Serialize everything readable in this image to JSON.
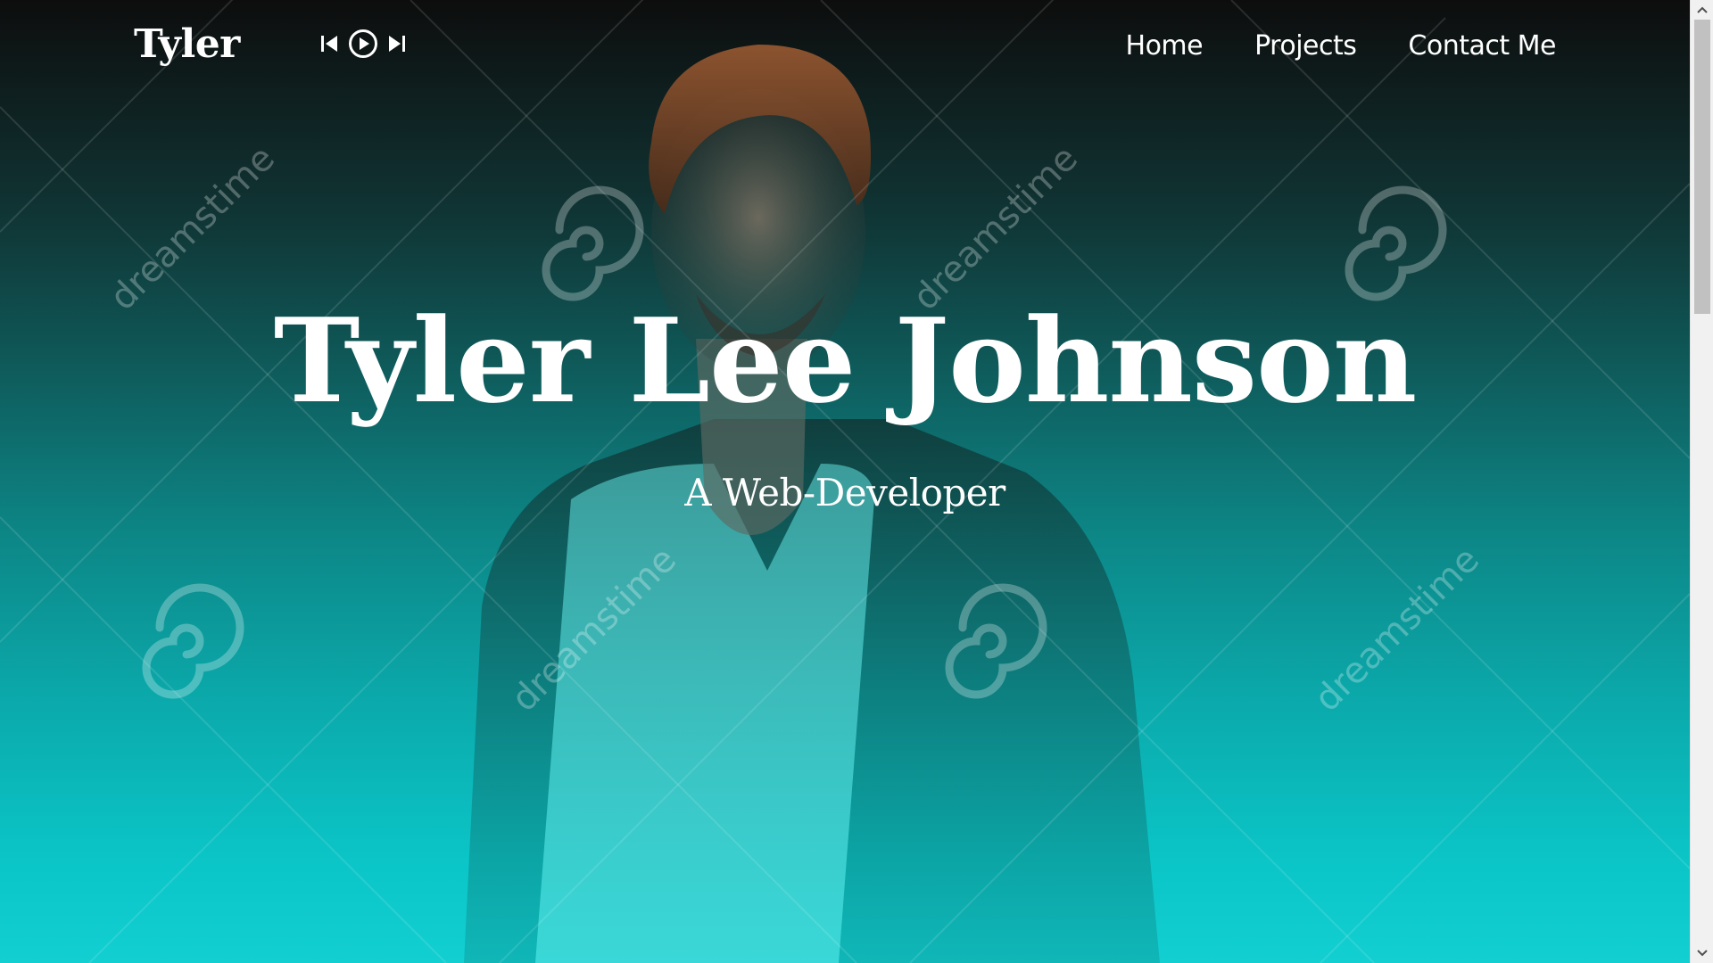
{
  "nav": {
    "brand": "Tyler",
    "links": [
      "Home",
      "Projects",
      "Contact Me"
    ]
  },
  "player": {
    "prev_icon": "skip-back-icon",
    "play_icon": "play-circle-icon",
    "next_icon": "skip-forward-icon"
  },
  "hero": {
    "title": "Tyler Lee Johnson",
    "subtitle": "A Web-Developer"
  },
  "watermark": {
    "text": "dreamstime"
  },
  "colors": {
    "top": "#0d0d0d",
    "mid": "#0d8585",
    "bottom": "#12cfd1",
    "text": "#ffffff"
  },
  "scrollbar": {
    "position": 0.0
  }
}
